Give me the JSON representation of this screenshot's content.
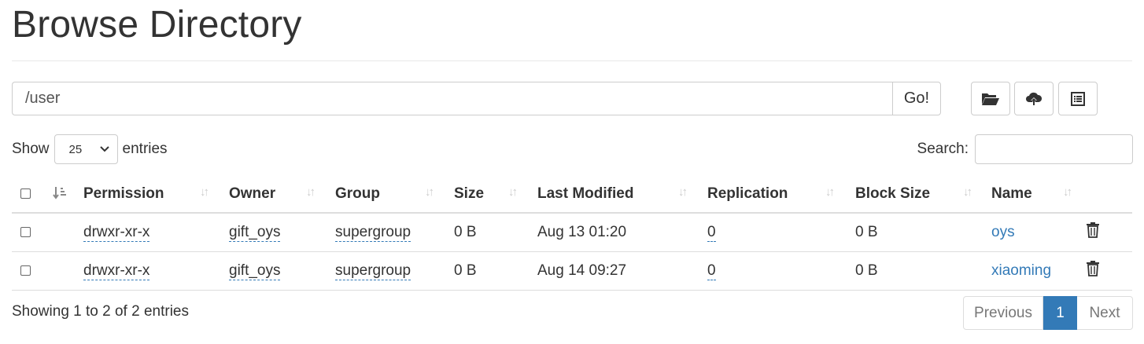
{
  "page": {
    "title": "Browse Directory"
  },
  "path_bar": {
    "value": "/user",
    "go_label": "Go!"
  },
  "toolbar": {
    "icons": [
      "folder-open-icon",
      "cloud-upload-icon",
      "list-alt-icon"
    ]
  },
  "length": {
    "show_label": "Show",
    "value": "25",
    "entries_label": "entries"
  },
  "search": {
    "label": "Search:"
  },
  "table": {
    "columns": [
      "Permission",
      "Owner",
      "Group",
      "Size",
      "Last Modified",
      "Replication",
      "Block Size",
      "Name"
    ],
    "rows": [
      {
        "permission": "drwxr-xr-x",
        "owner": "gift_oys",
        "group": "supergroup",
        "size": "0 B",
        "modified": "Aug 13 01:20",
        "replication": "0",
        "block_size": "0 B",
        "name": "oys"
      },
      {
        "permission": "drwxr-xr-x",
        "owner": "gift_oys",
        "group": "supergroup",
        "size": "0 B",
        "modified": "Aug 14 09:27",
        "replication": "0",
        "block_size": "0 B",
        "name": "xiaoming"
      }
    ]
  },
  "info": {
    "text": "Showing 1 to 2 of 2 entries"
  },
  "pagination": {
    "previous": "Previous",
    "current": "1",
    "next": "Next",
    "active_color": "#337ab7"
  }
}
